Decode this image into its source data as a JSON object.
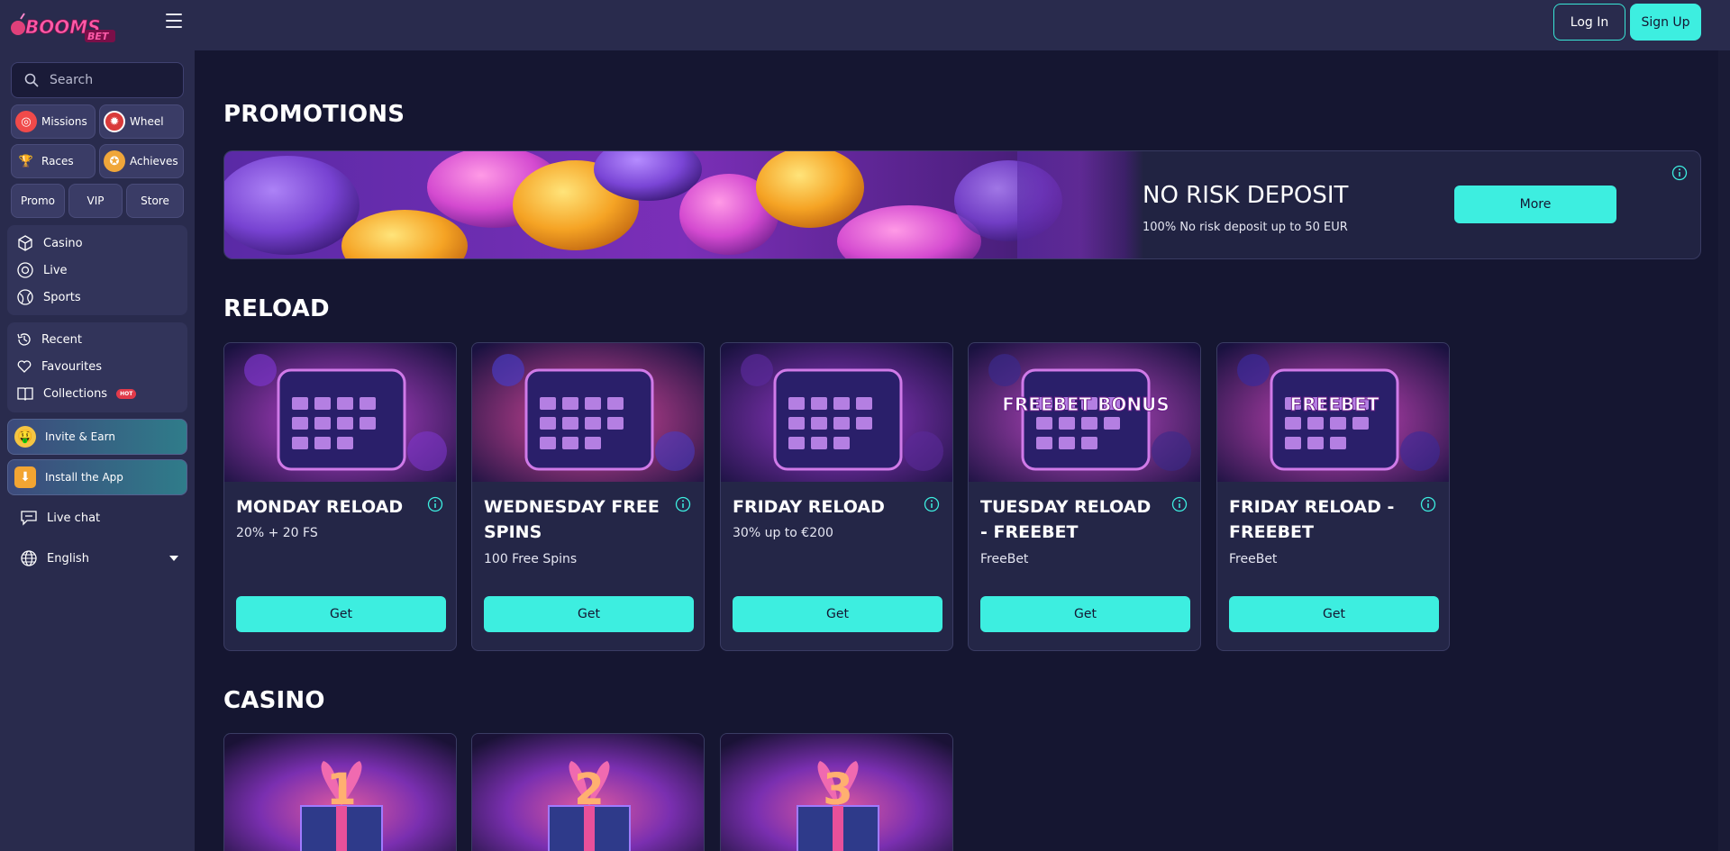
{
  "brand": {
    "logo_text": "BOOMS",
    "logo_sub": "BET"
  },
  "header": {
    "login_label": "Log In",
    "signup_label": "Sign Up"
  },
  "sidebar": {
    "search_placeholder": "Search",
    "quick": [
      {
        "label": "Missions",
        "icon": "target-icon"
      },
      {
        "label": "Wheel",
        "icon": "wheel-icon"
      },
      {
        "label": "Races",
        "icon": "trophy-icon"
      },
      {
        "label": "Achieves",
        "icon": "medal-icon"
      }
    ],
    "tabs": [
      "Promo",
      "VIP",
      "Store"
    ],
    "main_nav": [
      {
        "label": "Casino",
        "icon": "cube-icon"
      },
      {
        "label": "Live",
        "icon": "live-icon"
      },
      {
        "label": "Sports",
        "icon": "ball-icon"
      }
    ],
    "user_nav": [
      {
        "label": "Recent",
        "icon": "history-icon"
      },
      {
        "label": "Favourites",
        "icon": "heart-icon"
      },
      {
        "label": "Collections",
        "icon": "book-icon",
        "badge": "HOT"
      }
    ],
    "invite_label": "Invite & Earn",
    "install_label": "Install the App",
    "live_chat_label": "Live chat",
    "language_label": "English"
  },
  "main": {
    "promotions_title": "PROMOTIONS",
    "banner": {
      "title": "NO RISK DEPOSIT",
      "subtitle": "100% No risk deposit up to 50 EUR",
      "button_label": "More"
    },
    "reload_title": "RELOAD",
    "reload_cards": [
      {
        "title": "MONDAY RELOAD",
        "subtitle": "20% + 20 FS",
        "button_label": "Get",
        "art_text": ""
      },
      {
        "title": "WEDNESDAY FREE SPINS",
        "subtitle": "100 Free Spins",
        "button_label": "Get",
        "art_text": ""
      },
      {
        "title": "FRIDAY RELOAD",
        "subtitle": "30% up to €200",
        "button_label": "Get",
        "art_text": ""
      },
      {
        "title": "TUESDAY RELOAD - FREEBET",
        "subtitle": "FreeBet",
        "button_label": "Get",
        "art_text": "FREEBET BONUS"
      },
      {
        "title": "FRIDAY RELOAD - FREEBET",
        "subtitle": "FreeBet",
        "button_label": "Get",
        "art_text": "FREEBET"
      }
    ],
    "casino_title": "CASINO",
    "casino_cards": [
      {
        "art_number": "1"
      },
      {
        "art_number": "2"
      },
      {
        "art_number": "3"
      }
    ]
  },
  "colors": {
    "accent": "#3deee0",
    "background": "#151631",
    "sidebar": "#292b4d",
    "card": "#242647",
    "hot": "#e23a4a"
  }
}
